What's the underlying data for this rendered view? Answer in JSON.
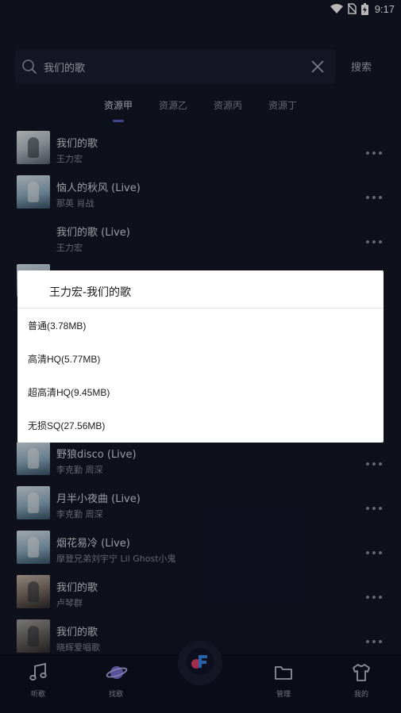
{
  "status_bar": {
    "time": "9:17"
  },
  "search": {
    "value": "我们的歌",
    "button_label": "搜索"
  },
  "tabs": [
    {
      "label": "资源甲",
      "active": true
    },
    {
      "label": "资源乙",
      "active": false
    },
    {
      "label": "资源丙",
      "active": false
    },
    {
      "label": "资源丁",
      "active": false
    }
  ],
  "songs": [
    {
      "title": "我们的歌",
      "artist": "王力宏"
    },
    {
      "title": "恼人的秋风 (Live)",
      "artist": "那英  肖战"
    },
    {
      "title": "我们的歌 (Live)",
      "artist": "王力宏"
    },
    {
      "title": "野狼disco (Live)",
      "artist": "李克勤  周深"
    },
    {
      "title": "月半小夜曲 (Live)",
      "artist": "李克勤  周深"
    },
    {
      "title": "烟花易冷 (Live)",
      "artist": "摩登兄弟刘宇宁  Lil Ghost小鬼"
    },
    {
      "title": "我们的歌",
      "artist": "卢琴群"
    },
    {
      "title": "我们的歌",
      "artist": "晓辉爱唱歌"
    }
  ],
  "dialog": {
    "title": "王力宏-我们的歌",
    "options": [
      "普通(3.78MB)",
      "高清HQ(5.77MB)",
      "超高清HQ(9.45MB)",
      "无损SQ(27.56MB)"
    ]
  },
  "bottom_nav": {
    "items": [
      {
        "label": "听歌",
        "icon": "music-note-icon"
      },
      {
        "label": "找歌",
        "icon": "planet-icon"
      },
      {
        "label": "管理",
        "icon": "folder-icon"
      },
      {
        "label": "我的",
        "icon": "tshirt-icon"
      }
    ]
  },
  "colors": {
    "background": "#141728",
    "accent": "#5563c7",
    "dialog": "#ffffff"
  }
}
